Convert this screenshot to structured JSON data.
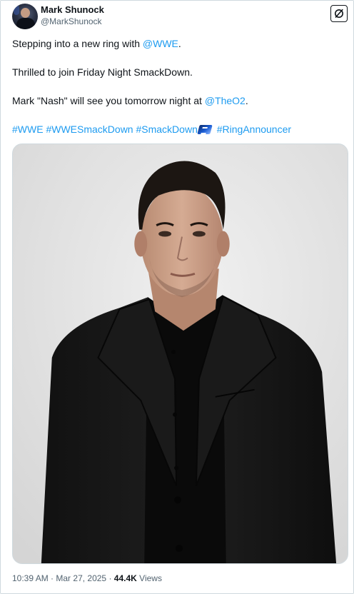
{
  "author": {
    "display_name": "Mark Shunock",
    "handle": "@MarkShunock"
  },
  "post": {
    "line1": {
      "prefix": "Stepping into a new ring with ",
      "mention": "@WWE",
      "suffix": "."
    },
    "line2": "Thrilled to join Friday Night SmackDown.",
    "line3": {
      "prefix": "Mark \"Nash\" will see you tomorrow night at ",
      "mention": "@TheO2",
      "suffix": "."
    },
    "hashtags": [
      "#WWE",
      "#WWESmackDown",
      "#SmackDown",
      "#RingAnnouncer"
    ]
  },
  "media": {
    "type": "photo",
    "icon": "smackdown-emoji"
  },
  "meta": {
    "time": "10:39 AM",
    "separator": "·",
    "date": "Mar 27, 2025",
    "views_count": "44.4K",
    "views_label": "Views"
  },
  "colors": {
    "link": "#1d9bf0",
    "text": "#0f1419",
    "secondary": "#536471",
    "border": "#cfd9de"
  }
}
